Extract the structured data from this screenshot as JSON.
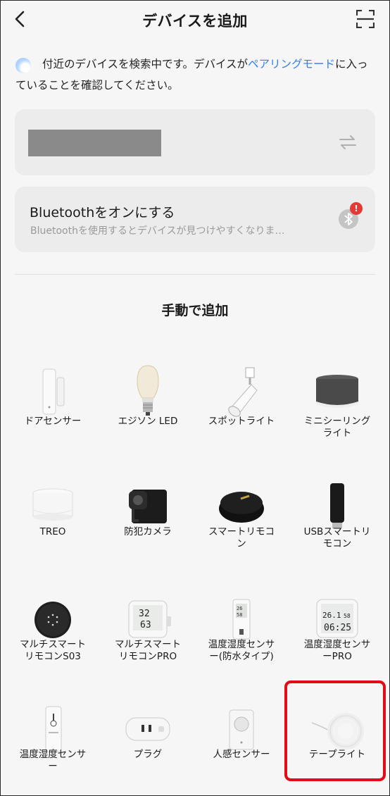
{
  "header": {
    "title": "デバイスを追加",
    "back_icon": "chevron-left-icon",
    "scan_icon": "scan-icon"
  },
  "notice": {
    "text_before": "付近のデバイスを検索中です。デバイスが",
    "link": "ペアリングモード",
    "text_after": "に入っていることを確認してください。"
  },
  "bluetooth": {
    "title": "Bluetoothをオンにする",
    "subtitle": "Bluetoothを使用するとデバイスが見つけやすくなりま…",
    "badge": "!"
  },
  "section_title": "手動で追加",
  "devices": [
    {
      "label": "ドアセンサー",
      "icon": "door-sensor"
    },
    {
      "label": "エジソン LED",
      "icon": "edison-bulb"
    },
    {
      "label": "スポットライト",
      "icon": "spotlight"
    },
    {
      "label": "ミニシーリング\nライト",
      "icon": "mini-ceiling-light"
    },
    {
      "label": "TREO",
      "icon": "treo-light"
    },
    {
      "label": "防犯カメラ",
      "icon": "security-camera"
    },
    {
      "label": "スマートリモコ\nン",
      "icon": "smart-remote"
    },
    {
      "label": "USBスマートリ\nモコン",
      "icon": "usb-remote"
    },
    {
      "label": "マルチスマート\nリモコンS03",
      "icon": "multi-remote-s03"
    },
    {
      "label": "マルチスマート\nリモコンPRO",
      "icon": "multi-remote-pro"
    },
    {
      "label": "温度湿度センサ\nー(防水タイプ)",
      "icon": "waterproof-thermo"
    },
    {
      "label": "温度湿度センサ\nーPRO",
      "icon": "thermo-pro"
    },
    {
      "label": "温度湿度センサ\nー",
      "icon": "thermo-sensor"
    },
    {
      "label": "プラグ",
      "icon": "plug"
    },
    {
      "label": "人感センサー",
      "icon": "motion-sensor"
    },
    {
      "label": "テープライト",
      "icon": "tape-light"
    }
  ],
  "colors": {
    "link": "#2e7ff0",
    "highlight": "#e30b17",
    "badge": "#e53935"
  }
}
